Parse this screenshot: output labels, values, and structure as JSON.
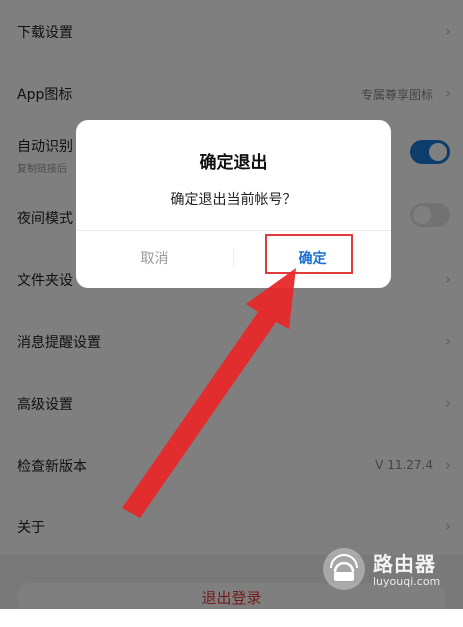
{
  "settings": {
    "rows": [
      {
        "label": "下载设置"
      },
      {
        "label": "App图标",
        "value": "专属尊享图标"
      },
      {
        "label": "自动识别",
        "sub": "复制链接后"
      },
      {
        "label": "夜间模式"
      },
      {
        "label": "文件夹设"
      },
      {
        "label": "消息提醒设置"
      },
      {
        "label": "高级设置"
      },
      {
        "label": "检查新版本",
        "value": "V 11.27.4"
      },
      {
        "label": "关于"
      }
    ],
    "toggles": {
      "auto_detect": "on",
      "night_mode": "off"
    },
    "logout_label": "退出登录"
  },
  "dialog": {
    "title": "确定退出",
    "message": "确定退出当前帐号？",
    "cancel_label": "取消",
    "confirm_label": "确定"
  },
  "icons": {
    "chevron": "chevron-right-icon",
    "arrow": "red-pointer-arrow",
    "watermark": "router-logo-icon"
  },
  "colors": {
    "accent": "#1a7cd6",
    "annotation": "#e23b3b",
    "confirm_text": "#1a6fd1"
  },
  "watermark": {
    "title": "路由器",
    "subtitle": "luyouqi.com"
  }
}
